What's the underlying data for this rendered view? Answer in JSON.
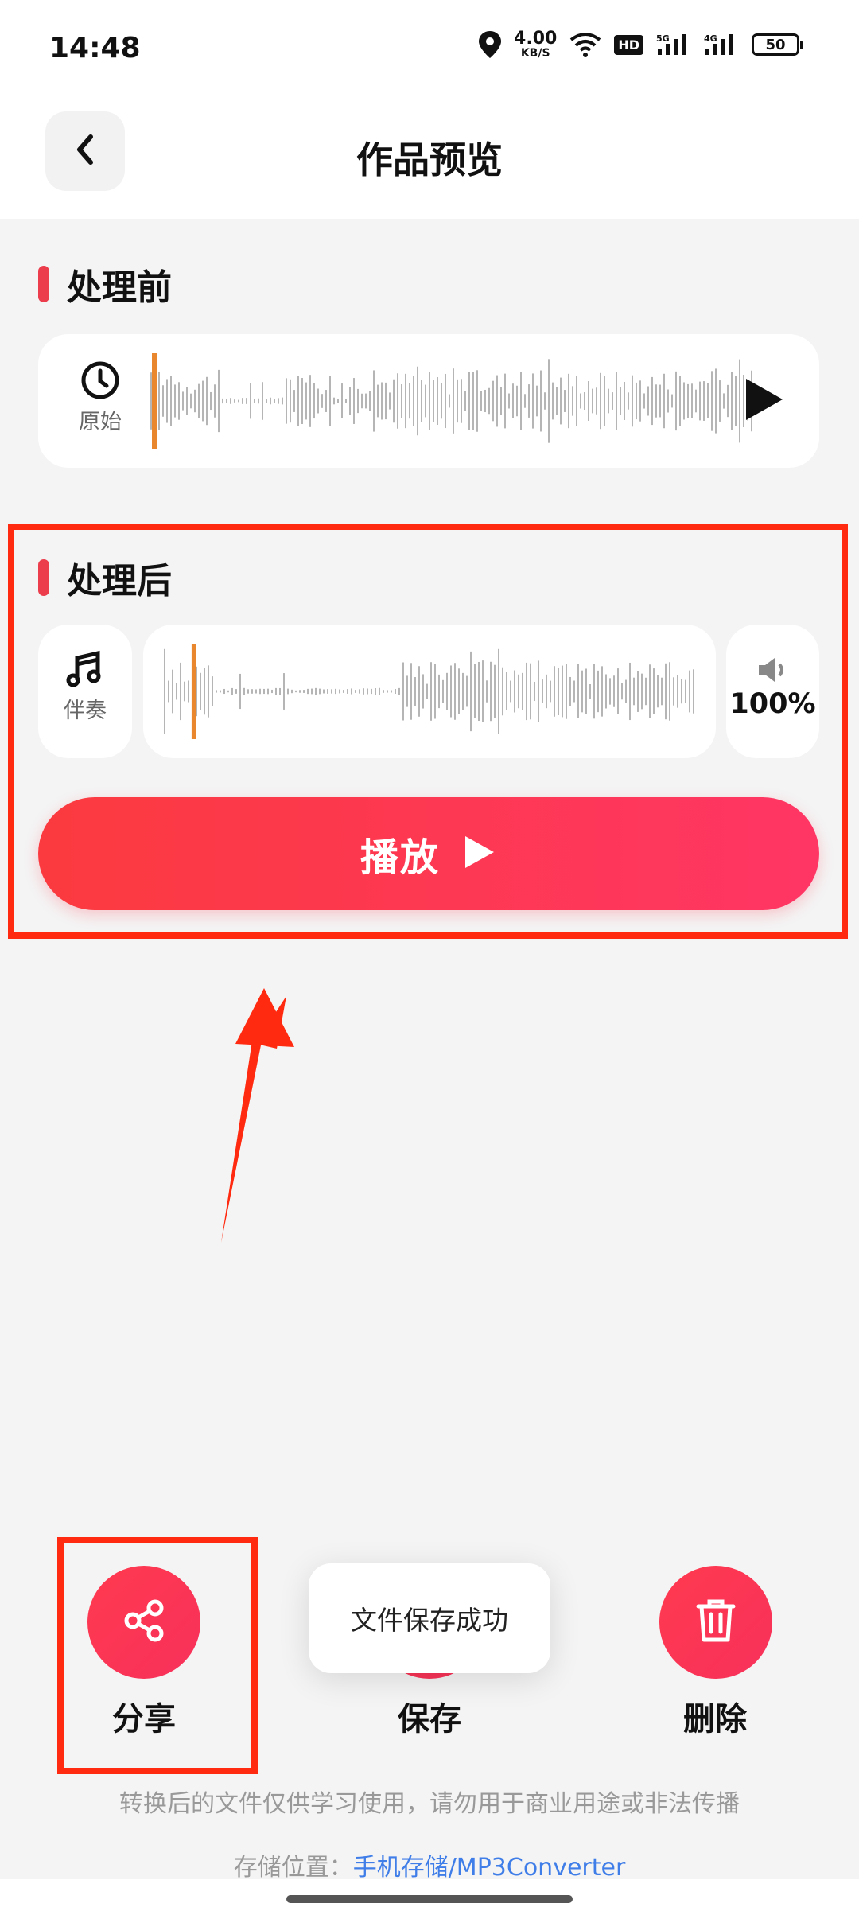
{
  "status_bar": {
    "time": "14:48",
    "net_speed_value": "4.00",
    "net_speed_unit": "KB/S",
    "hd_badge": "HD",
    "signal1_label": "5G",
    "signal2_label": "4G",
    "battery": "50",
    "icons": [
      "location-icon",
      "wifi-icon",
      "signal-icon",
      "battery-icon"
    ]
  },
  "header": {
    "title": "作品预览",
    "back_icon": "chevron-left-icon"
  },
  "before": {
    "section_title": "处理前",
    "track_label": "原始",
    "track_icon": "clock-icon",
    "play_icon": "play-icon",
    "playhead_fraction": 0.0
  },
  "after": {
    "section_title": "处理后",
    "track_label": "伴奏",
    "track_icon": "music-note-icon",
    "volume_icon": "speaker-icon",
    "volume": "100%",
    "playhead_fraction": 0.05,
    "play_button_label": "播放"
  },
  "actions": {
    "share_label": "分享",
    "save_label": "保存",
    "delete_label": "删除",
    "share_icon": "share-icon",
    "delete_icon": "trash-icon"
  },
  "toast": "文件保存成功",
  "footer": {
    "disclaimer": "转换后的文件仅供学习使用，请勿用于商业用途或非法传播",
    "storage_prefix": "存储位置：",
    "storage_link_cn": "手机存储",
    "storage_link_path": "/MP3Converter"
  },
  "colors": {
    "accent_red": "#fb3a3f",
    "accent_pink": "#ff3664",
    "annotation_red": "#ff2a0f",
    "playhead_orange": "#e8872e",
    "link_blue": "#3f7de8"
  }
}
